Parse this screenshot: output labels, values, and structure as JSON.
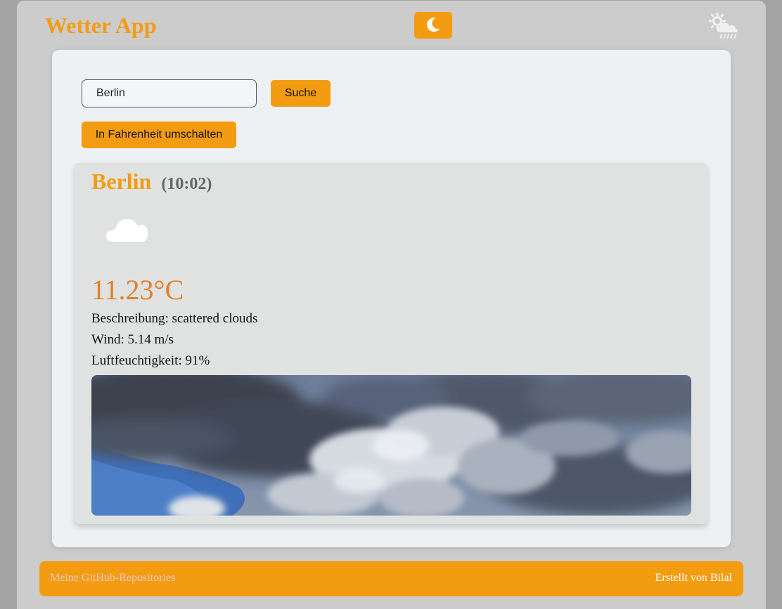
{
  "header": {
    "title": "Wetter App",
    "theme_toggle_icon": "moon-icon",
    "weather_icon": "sun-cloud-rain-icon"
  },
  "search": {
    "value": "Berlin",
    "button_label": "Suche"
  },
  "unit_toggle": {
    "label": "In Fahrenheit umschalten"
  },
  "weather": {
    "city": "Berlin",
    "time": "(10:02)",
    "condition_icon": "cloud-icon",
    "temperature": "11.23°C",
    "description_label": "Beschreibung:",
    "description_value": "scattered clouds",
    "wind_label": "Wind:",
    "wind_value": "5.14 m/s",
    "humidity_label": "Luftfeuchtigkeit:",
    "humidity_value": "91%",
    "photo": "cloudy-sky-photo"
  },
  "footer": {
    "link_label": "Meine GitHub-Repositories",
    "credit": "Erstellt von Bilal"
  },
  "colors": {
    "accent": "#f39c12",
    "temperature": "#e67e22",
    "time": "#666666",
    "shell_bg": "#cccccc",
    "card_bg": "#eef1f3",
    "weather_card_bg": "#e0e2e2"
  }
}
